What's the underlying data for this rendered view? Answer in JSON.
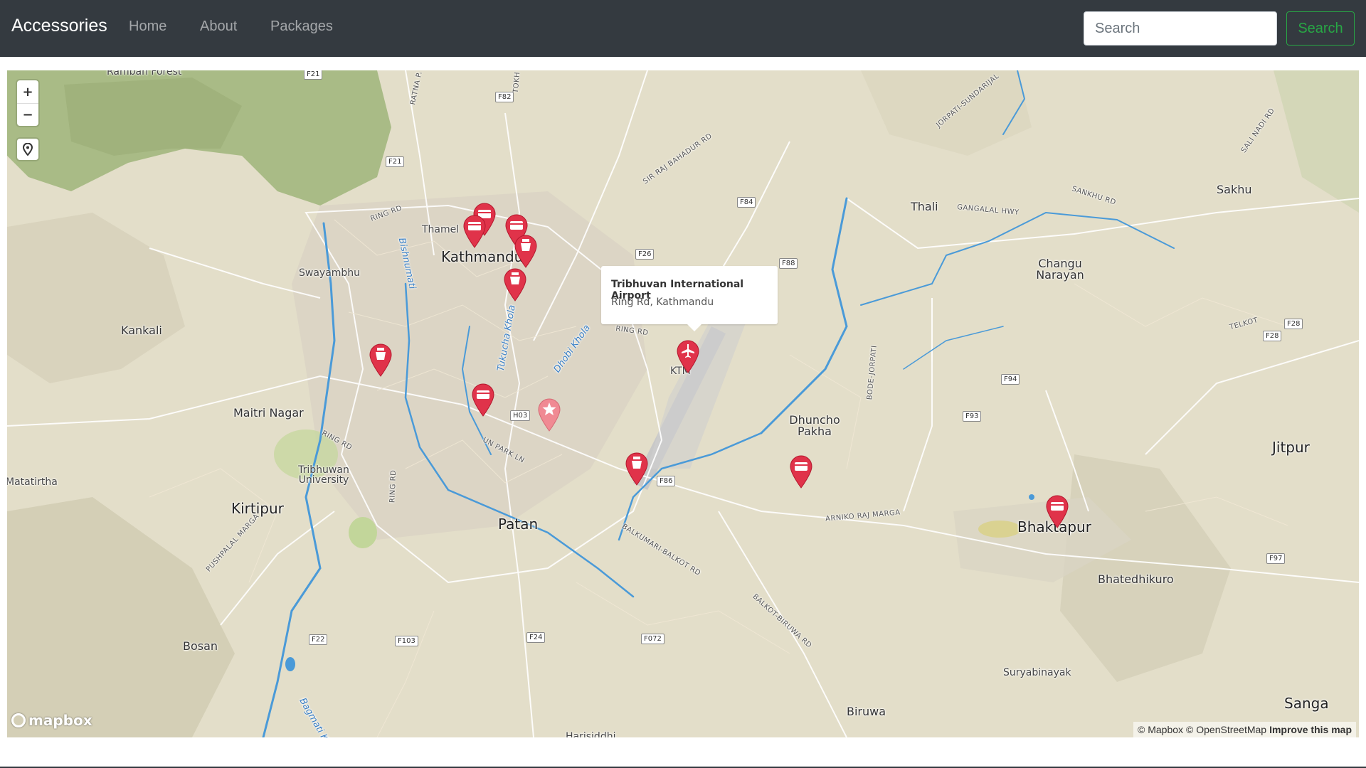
{
  "navbar": {
    "brand": "Accessories",
    "links": [
      "Home",
      "About",
      "Packages"
    ],
    "search_placeholder": "Search",
    "search_button": "Search"
  },
  "map": {
    "controls": {
      "zoom_in": "+",
      "zoom_out": "−"
    },
    "popup": {
      "title": "Tribhuvan International Airport",
      "subtitle": "Ring Rd, Kathmandu"
    },
    "place_labels": {
      "kathmandu": "Kathmandu",
      "patan": "Patan",
      "kirtipur": "Kirtipur",
      "bhaktapur": "Bhaktapur",
      "thamel": "Thamel",
      "swayambhu": "Swayambhu",
      "kankali": "Kankali",
      "maitri_nagar": "Maitri Nagar",
      "tribhuvan_university": "Tribhuwan University",
      "matatirtha": "Matatirtha",
      "bosan": "Bosan",
      "thali": "Thali",
      "sakhu": "Sakhu",
      "changu_narayan": "Changu Narayan",
      "dhuncho_pakha": "Dhuncho Pakha",
      "jitpur": "Jitpur",
      "bhatedhikuro": "Bhatedhikuro",
      "suryabinayak": "Suryabinayak",
      "sanga": "Sanga",
      "biruwa": "Biruwa",
      "harisiddhi": "Harisiddhi",
      "ktm": "KTM",
      "ramban_forest": "Ramban Forest"
    },
    "road_labels": {
      "ring_rd_1": "RING RD",
      "ring_rd_2": "RING RD",
      "ring_rd_3": "RING RD",
      "ring_rd_4": "RING RD",
      "un_park_ln": "UN PARK LN",
      "sir_raj_bahadur_rd": "SIR RAJ BAHADUR RD",
      "gangalal_hwy": "GANGALAL HWY",
      "sankhu_rd": "SANKHU RD",
      "jorpati_sundarijal": "JORPATI-SUNDARIJAL",
      "sali_nadi_rd": "SALI NADI RD",
      "telkot": "TELKOT",
      "arniko_raj_marga": "ARNIKO RAJ MARGA",
      "balkumari_balkot_rd": "BALKUMARI-BALKOT RD",
      "balkot_biruwa_rd": "BALKOT-BIRUWA RD",
      "pushpalal_marga": "PUSHPALAL MARGA",
      "bode_jorpati": "BODE-JORPATI",
      "ratna_park": "RATNA P.",
      "tokha": "TOKH"
    },
    "river_labels": {
      "bishnumati": "Bishnumati",
      "tukucha_khola": "Tukucha Khola",
      "dhobi_khola": "Dhobi Khola",
      "bagmati": "Bagmati Kh"
    },
    "road_shields": [
      "F21",
      "F82",
      "F21",
      "F84",
      "F26",
      "F88",
      "H03",
      "F86",
      "F94",
      "F93",
      "F28",
      "F28",
      "F97",
      "F22",
      "F103",
      "F24",
      "F072"
    ],
    "markers": [
      {
        "type": "atm",
        "color": "#e0334a"
      },
      {
        "type": "atm",
        "color": "#e0334a"
      },
      {
        "type": "atm",
        "color": "#e0334a"
      },
      {
        "type": "toilet",
        "color": "#e0334a"
      },
      {
        "type": "toilet",
        "color": "#e0334a"
      },
      {
        "type": "toilet",
        "color": "#e0334a"
      },
      {
        "type": "atm",
        "color": "#e0334a"
      },
      {
        "type": "star",
        "color": "#f08a93"
      },
      {
        "type": "airport",
        "color": "#e0334a"
      },
      {
        "type": "toilet",
        "color": "#e0334a"
      },
      {
        "type": "atm",
        "color": "#e0334a"
      },
      {
        "type": "atm",
        "color": "#e0334a"
      }
    ],
    "logo": "mapbox",
    "attribution": {
      "mapbox": "© Mapbox",
      "osm": "© OpenStreetMap",
      "improve": "Improve this map"
    }
  },
  "colors": {
    "navbar_bg": "#343a40",
    "accent_green": "#28a745",
    "marker_red": "#e0334a",
    "map_land": "#e2ddc9",
    "river": "#4a9ad8"
  }
}
